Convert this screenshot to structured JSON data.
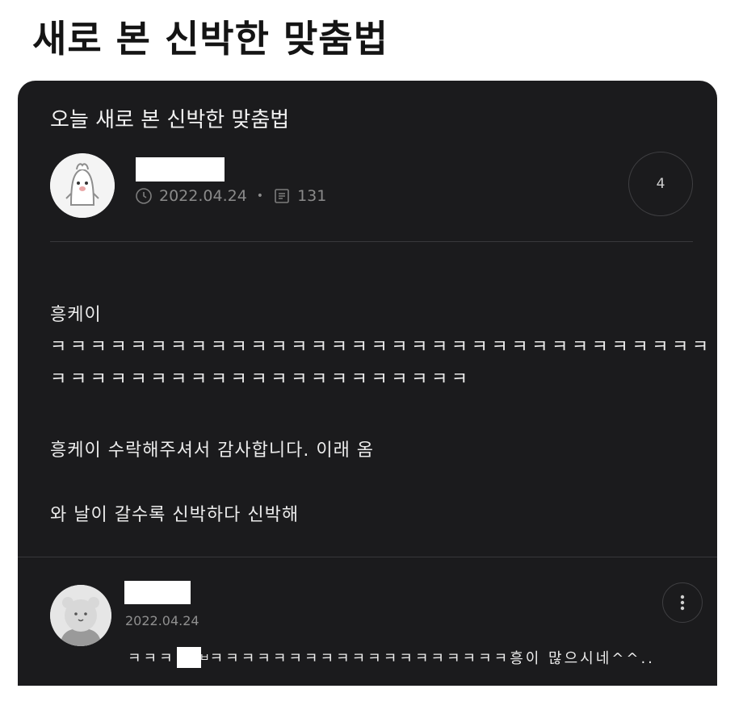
{
  "page_title": "새로 본 신박한 맞춤법",
  "post": {
    "title": "오늘 새로 본 신박한 맞춤법",
    "date": "2022.04.24",
    "views": "131",
    "comment_count": "4",
    "icons": {
      "date": "clock-icon",
      "views": "document-icon"
    },
    "body": [
      "흥케이",
      "ㅋㅋㅋㅋㅋㅋㅋㅋㅋㅋㅋㅋㅋㅋㅋㅋㅋㅋㅋㅋㅋㅋㅋㅋㅋㅋㅋㅋㅋㅋㅋㅋㅋ",
      "ㅋㅋㅋㅋㅋㅋㅋㅋㅋㅋㅋㅋㅋㅋㅋㅋㅋㅋㅋㅋㅋ",
      "흥케이 수락해주셔서 감사합니다. 이래 옴",
      "와 날이 갈수록 신박하다 신박해"
    ]
  },
  "comment": {
    "date": "2022.04.24",
    "text_start": "ㅋㅋㅋ",
    "text_rest": "ㅋㅋㅋㅋㅋㅋㅋㅋㅋㅋㅋㅋㅋㅋㅋㅋㅋㅋㅋ흥이 많으시네^^..",
    "partial_char": "ㅂ"
  },
  "colors": {
    "card_bg": "#1b1b1d",
    "text": "#ececec",
    "muted": "#8a8a8a",
    "redaction": "#ffffff"
  }
}
